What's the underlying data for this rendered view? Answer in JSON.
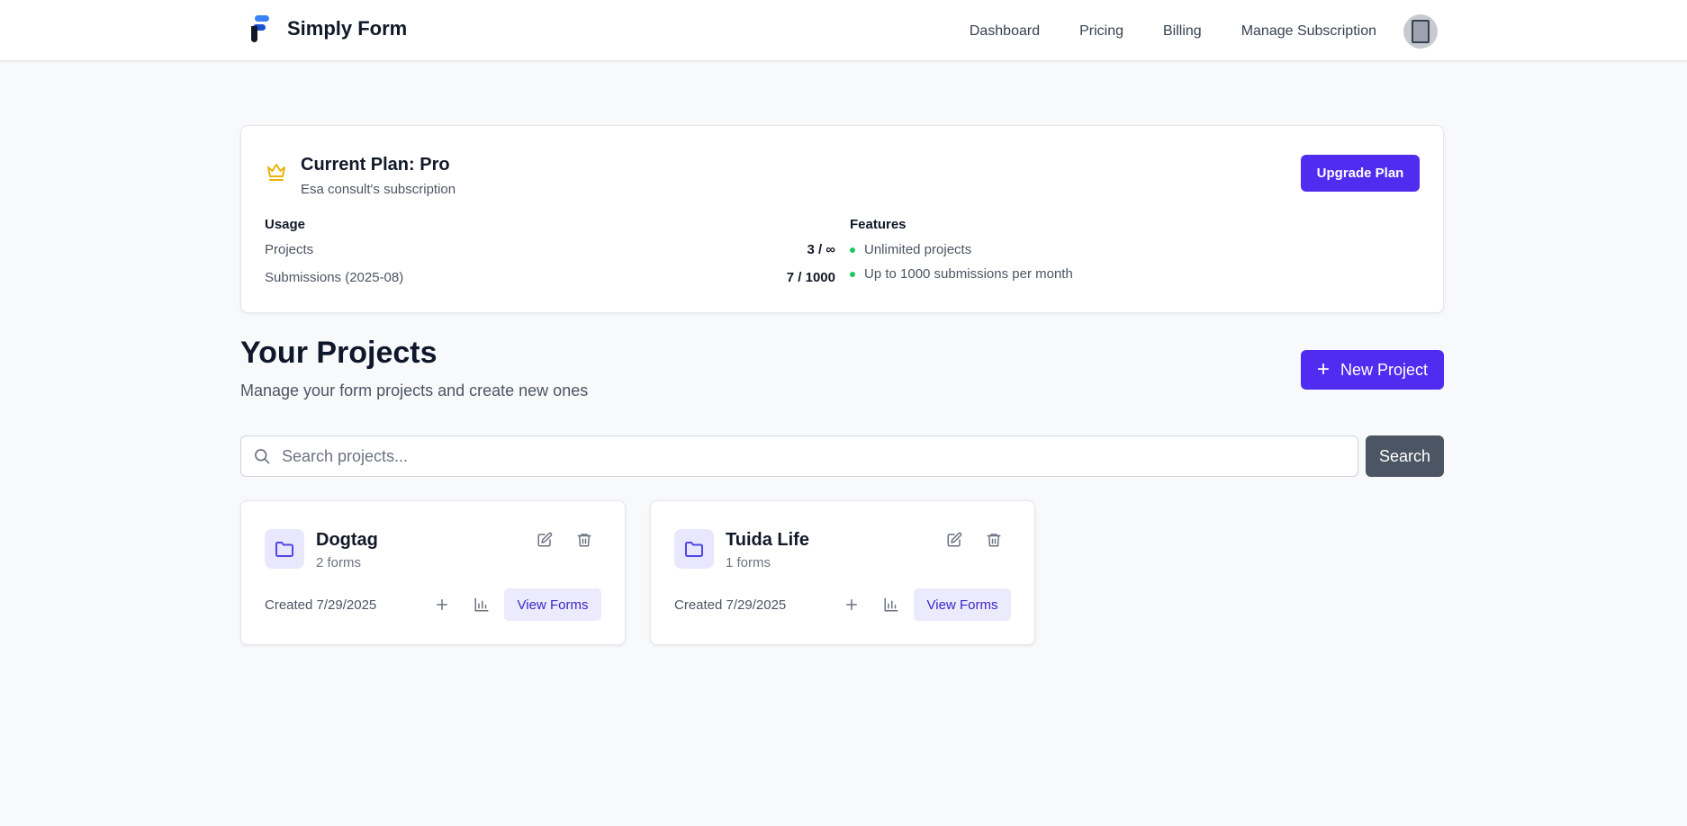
{
  "header": {
    "brand": "Simply Form",
    "nav": [
      "Dashboard",
      "Pricing",
      "Billing",
      "Manage Subscription"
    ]
  },
  "plan": {
    "title": "Current Plan: Pro",
    "subtitle": "Esa consult's subscription",
    "upgrade_label": "Upgrade Plan",
    "usage_title": "Usage",
    "usage": [
      {
        "label": "Projects",
        "value": "3 / ∞"
      },
      {
        "label": "Submissions (2025-08)",
        "value": "7 / 1000"
      }
    ],
    "features_title": "Features",
    "features": [
      "Unlimited projects",
      "Up to 1000 submissions per month"
    ]
  },
  "projects": {
    "title": "Your Projects",
    "subtitle": "Manage your form projects and create new ones",
    "new_label": "New Project",
    "search_placeholder": "Search projects...",
    "search_value": "",
    "search_label": "Search",
    "items": [
      {
        "name": "Dogtag",
        "forms": "2 forms",
        "created": "Created 7/29/2025",
        "view_label": "View Forms"
      },
      {
        "name": "Tuida Life",
        "forms": "1 forms",
        "created": "Created 7/29/2025",
        "view_label": "View Forms"
      }
    ]
  },
  "colors": {
    "primary": "#4f2cf0",
    "search_button": "#4b5563",
    "feature_dot": "#22c55e",
    "crown": "#eab308"
  }
}
